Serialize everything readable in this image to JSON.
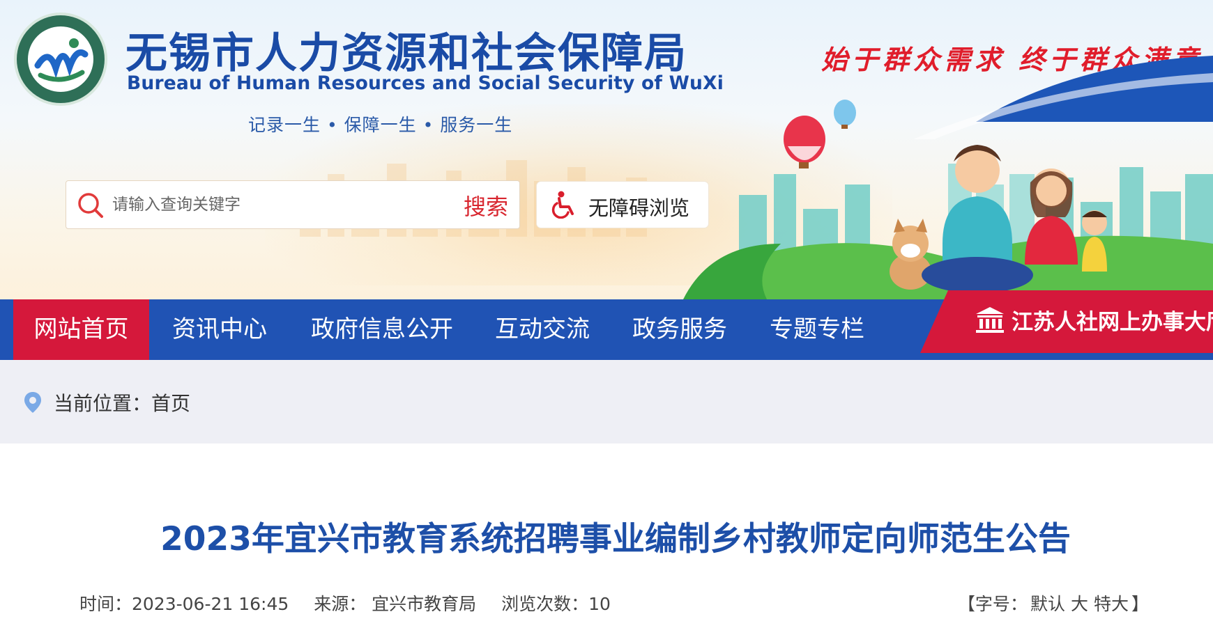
{
  "header": {
    "title_cn": "无锡市人力资源和社会保障局",
    "title_en": "Bureau of  Human Resources and Social Security of WuXi",
    "motto": "记录一生 • 保障一生 • 服务一生",
    "slogan": "始于群众需求  终于群众满意",
    "logo_icon": "wuxi-hrss-logo",
    "colors": {
      "brand_blue": "#1a4ba6",
      "slogan_red": "#e01d2b"
    }
  },
  "search": {
    "placeholder": "请输入查询关键字",
    "button_label": "搜索",
    "icon": "search-icon"
  },
  "accessibility": {
    "label": "无障碍浏览",
    "icon": "wheelchair-icon"
  },
  "nav": {
    "items": [
      {
        "label": "网站首页",
        "active": true
      },
      {
        "label": "资讯中心",
        "active": false
      },
      {
        "label": "政府信息公开",
        "active": false
      },
      {
        "label": "互动交流",
        "active": false
      },
      {
        "label": "政务服务",
        "active": false
      },
      {
        "label": "专题专栏",
        "active": false
      }
    ],
    "service_hall": {
      "label": "江苏人社网上办事大厅",
      "icon": "government-building-icon"
    },
    "colors": {
      "bar": "#2053b4",
      "active": "#d5183b"
    }
  },
  "breadcrumb": {
    "text": "当前位置：首页",
    "icon": "location-pin-icon"
  },
  "article": {
    "title": "2023年宜兴市教育系统招聘事业编制乡村教师定向师范生公告",
    "time": "时间：2023-06-21 16:45",
    "source": "来源：  宜兴市教育局",
    "views": "浏览次数：10",
    "font_size_prefix": "【字号：",
    "font_size_default": "默认",
    "font_size_large": "大",
    "font_size_xlarge": "特大",
    "font_size_suffix": "】"
  }
}
